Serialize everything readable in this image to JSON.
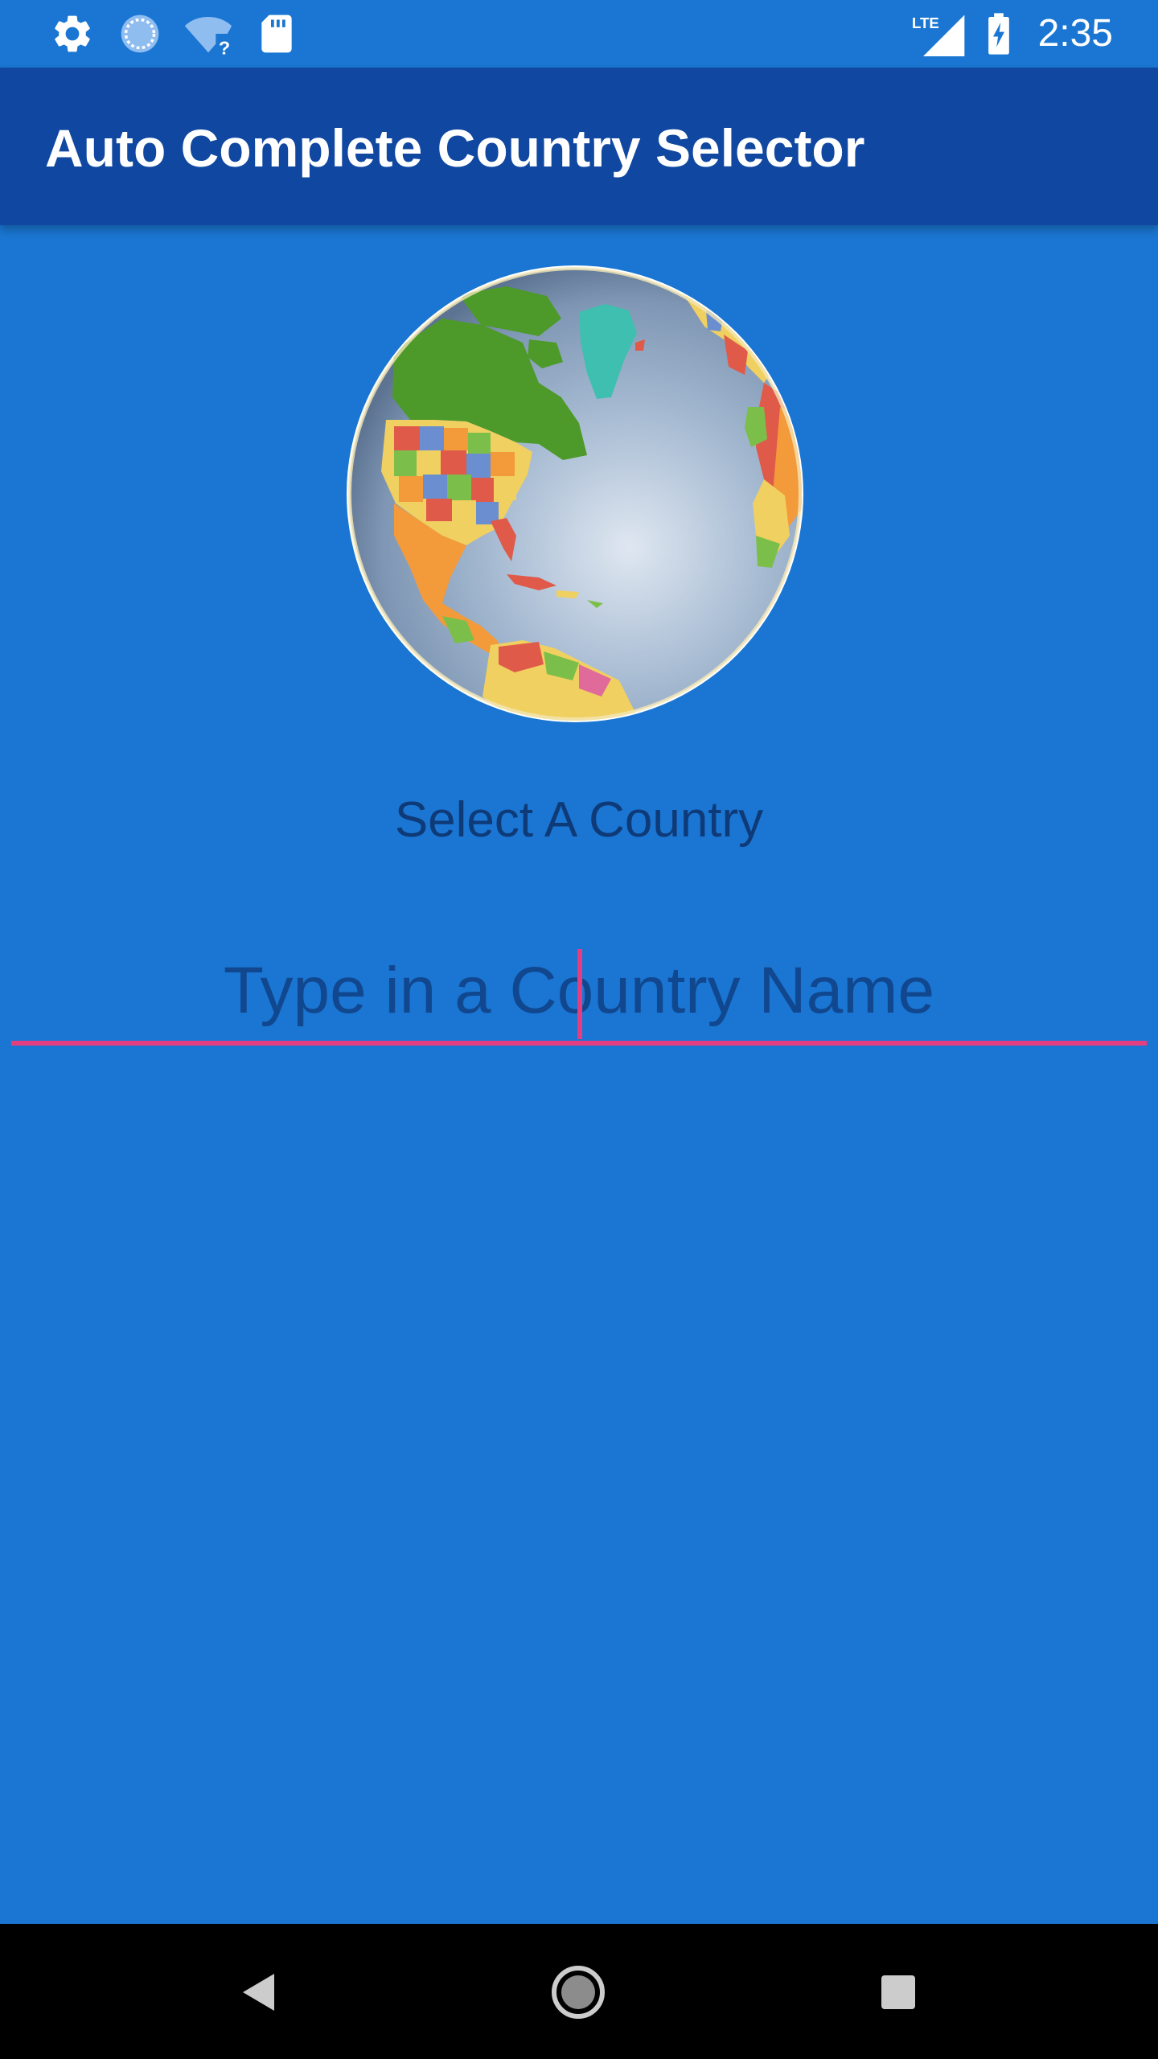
{
  "status_bar": {
    "time": "2:35",
    "network_label": "LTE",
    "icons": [
      "settings-icon",
      "sync-icon",
      "wifi-unknown-icon",
      "sd-card-icon",
      "lte-signal-icon",
      "battery-charging-icon"
    ]
  },
  "app_bar": {
    "title": "Auto Complete Country Selector"
  },
  "main": {
    "globe_image": "globe-icon",
    "label": "Select A Country",
    "input": {
      "placeholder": "Type in a Country Name",
      "value": ""
    }
  },
  "colors": {
    "background": "#1a76d2",
    "app_bar": "#0f47a1",
    "accent": "#e43e80",
    "label_text": "#0f3a78"
  },
  "nav_bar": {
    "buttons": [
      "back-icon",
      "home-icon",
      "recents-icon"
    ]
  }
}
